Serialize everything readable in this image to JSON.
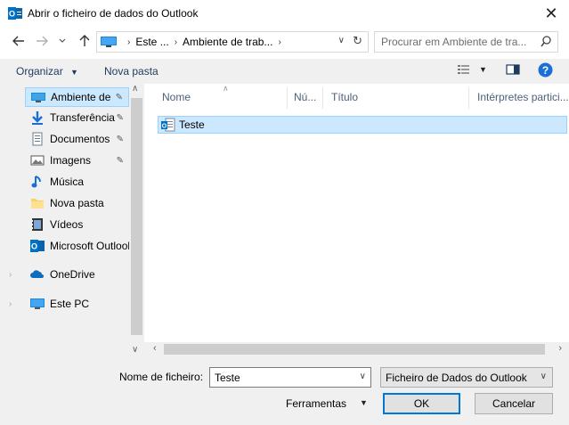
{
  "window": {
    "title": "Abrir o ficheiro de dados do Outlook",
    "app_icon": "outlook-icon",
    "close_label": "✕"
  },
  "navigation": {
    "back_icon": "arrow-left-icon",
    "forward_icon": "arrow-right-icon",
    "recent_icon": "chevron-down-icon",
    "up_icon": "arrow-up-icon",
    "breadcrumbs": [
      "Este ...",
      "Ambiente de trab..."
    ],
    "search_placeholder": "Procurar em Ambiente de tra..."
  },
  "toolbar": {
    "organize_label": "Organizar",
    "new_folder_label": "Nova pasta"
  },
  "sidebar": {
    "items": [
      {
        "label": "Ambiente de",
        "icon": "desktop-icon",
        "pinned": true,
        "selected": true
      },
      {
        "label": "Transferência",
        "icon": "download-icon",
        "pinned": true
      },
      {
        "label": "Documentos",
        "icon": "documents-icon",
        "pinned": true
      },
      {
        "label": "Imagens",
        "icon": "pictures-icon",
        "pinned": true
      },
      {
        "label": "Música",
        "icon": "music-icon",
        "pinned": false
      },
      {
        "label": "Nova pasta",
        "icon": "folder-icon",
        "pinned": false
      },
      {
        "label": "Vídeos",
        "icon": "videos-icon",
        "pinned": false
      },
      {
        "label": "Microsoft Outlook",
        "icon": "outlook-icon",
        "pinned": false
      },
      {
        "label": "OneDrive",
        "icon": "onedrive-icon",
        "pinned": false
      },
      {
        "label": "Este PC",
        "icon": "pc-icon",
        "pinned": false
      }
    ]
  },
  "columns": [
    "Nome",
    "Nú...",
    "Título",
    "Intérpretes partici..."
  ],
  "files": [
    {
      "name": "Teste",
      "icon": "outlook-data-file-icon",
      "selected": true
    }
  ],
  "footer": {
    "filename_label": "Nome de ficheiro:",
    "filename_value": "Teste",
    "filetype_value": "Ficheiro de Dados do Outlook",
    "tools_label": "Ferramentas",
    "ok_label": "OK",
    "cancel_label": "Cancelar"
  },
  "colors": {
    "selection_bg": "#cce8ff",
    "selection_border": "#99d1ff",
    "accent": "#0078d7",
    "panel_bg": "#f0f0f0"
  }
}
